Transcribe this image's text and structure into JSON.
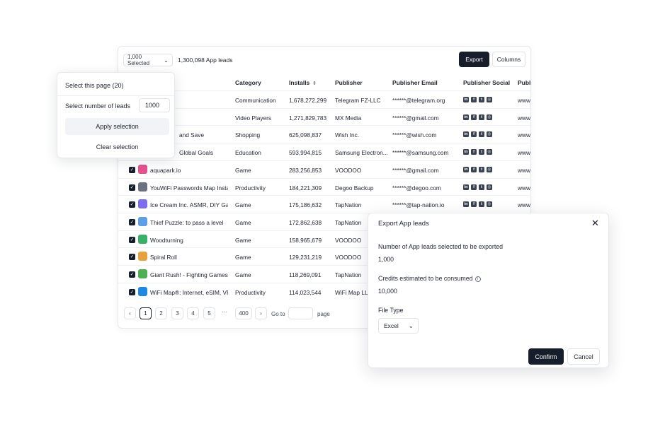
{
  "toolbar": {
    "selected_label": "1,000 Selected",
    "lead_count": "1,300,098 App leads",
    "export_label": "Export",
    "columns_label": "Columns"
  },
  "table": {
    "headers": {
      "category": "Category",
      "installs": "Installs",
      "publisher": "Publisher",
      "email": "Publisher Email",
      "social": "Publisher Social",
      "website": "Publis"
    },
    "rows": [
      {
        "name": "",
        "category": "Communication",
        "installs": "1,678,272,299",
        "publisher": "Telegram FZ-LLC",
        "email": "******@telegram.org",
        "website": "www.",
        "icon_color": "#2aa3e0",
        "checked": false
      },
      {
        "name": "",
        "category": "Video Players",
        "installs": "1,271,829,783",
        "publisher": "MX Media",
        "email": "******@gmail.com",
        "website": "www.",
        "icon_color": "#3b82f6",
        "checked": false
      },
      {
        "name": "and Save",
        "category": "Shopping",
        "installs": "625,098,837",
        "publisher": "Wish Inc.",
        "email": "******@wish.com",
        "website": "www.",
        "icon_color": "#2fb7ec",
        "checked": false
      },
      {
        "name": "Global Goals",
        "category": "Education",
        "installs": "593,994,815",
        "publisher": "Samsung Electron...",
        "email": "******@samsung.com",
        "website": "www.",
        "icon_color": "#1f6feb",
        "checked": false
      },
      {
        "name": "aquapark.io",
        "category": "Game",
        "installs": "283,256,853",
        "publisher": "VOODOO",
        "email": "******@gmail.com",
        "website": "www.",
        "icon_color": "#e8508f",
        "checked": true
      },
      {
        "name": "YouWiFi Passwords Map Instal",
        "category": "Productivity",
        "installs": "184,221,309",
        "publisher": "Degoo Backup",
        "email": "******@degoo.com",
        "website": "www.",
        "icon_color": "#6b7280",
        "checked": true
      },
      {
        "name": "Ice Cream Inc. ASMR, DIY Gam",
        "category": "Game",
        "installs": "175,186,632",
        "publisher": "TapNation",
        "email": "******@tap-nation.io",
        "website": "www.",
        "icon_color": "#7c6cf0",
        "checked": true
      },
      {
        "name": "Thief Puzzle: to pass a level",
        "category": "Game",
        "installs": "172,862,638",
        "publisher": "TapNation",
        "email": "",
        "website": "",
        "icon_color": "#5aa0e8",
        "checked": true
      },
      {
        "name": "Woodturning",
        "category": "Game",
        "installs": "158,965,679",
        "publisher": "VOODOO",
        "email": "",
        "website": "",
        "icon_color": "#38b26a",
        "checked": true
      },
      {
        "name": "Spiral Roll",
        "category": "Game",
        "installs": "129,231,219",
        "publisher": "VOODOO",
        "email": "",
        "website": "",
        "icon_color": "#e7a23b",
        "checked": true
      },
      {
        "name": "Giant Rush! - Fighting Games",
        "category": "Game",
        "installs": "118,269,091",
        "publisher": "TapNation",
        "email": "",
        "website": "",
        "icon_color": "#4caf50",
        "checked": true
      },
      {
        "name": "WiFi Map®: Internet, eSIM, VPN",
        "category": "Productivity",
        "installs": "114,023,544",
        "publisher": "WiFi Map LLC",
        "email": "",
        "website": "",
        "icon_color": "#1e88e5",
        "checked": true
      }
    ]
  },
  "pager": {
    "pages": [
      "1",
      "2",
      "3",
      "4",
      "5"
    ],
    "ellipsis": "···",
    "last": "400",
    "goto_label": "Go to",
    "page_label": "page"
  },
  "popover": {
    "title": "Select this page (20)",
    "number_label": "Select number of leads",
    "number_value": "1000",
    "apply_label": "Apply selection",
    "clear_label": "Clear selection"
  },
  "modal": {
    "title": "Export App leads",
    "count_label": "Number of App leads selected to be exported",
    "count_value": "1,000",
    "credits_label": "Credits estimated to be consumed",
    "credits_value": "10,000",
    "filetype_label": "File Type",
    "filetype_value": "Excel",
    "confirm_label": "Confirm",
    "cancel_label": "Cancel"
  },
  "colors": {
    "primary_dark": "#161d2b",
    "border": "#dfe2e7",
    "muted_bg": "#f1f3f6"
  }
}
